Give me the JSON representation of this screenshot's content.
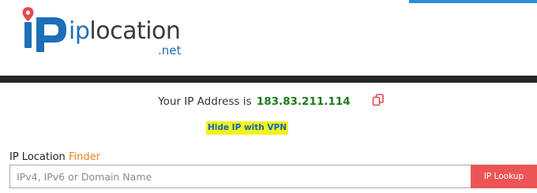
{
  "colors": {
    "brand_blue": "#1d6fb8",
    "brand_dark": "#3a3a3a",
    "pin_red": "#e5484d",
    "top_accent": "#2a8fd9",
    "dark_bar": "#262626",
    "ip_green": "#1c7a1c",
    "copy_icon": "#e5484d",
    "vpn_highlight": "#f2f21c",
    "vpn_text": "#1565c0",
    "finder_orange": "#e8821a",
    "lookup_bg": "#ec5555"
  },
  "logo": {
    "text_blue": "ip",
    "text_dark": "location",
    "suffix": ".net"
  },
  "ip_info": {
    "prefix": "Your IP Address is",
    "address": "183.83.211.114",
    "copy_icon": "copy-icon"
  },
  "vpn": {
    "label": "Hide IP with VPN"
  },
  "finder": {
    "label_main": "IP Location",
    "label_accent": "Finder"
  },
  "search": {
    "placeholder": "IPv4, IPv6 or Domain Name",
    "value": "",
    "button_label": "IP Lookup"
  }
}
